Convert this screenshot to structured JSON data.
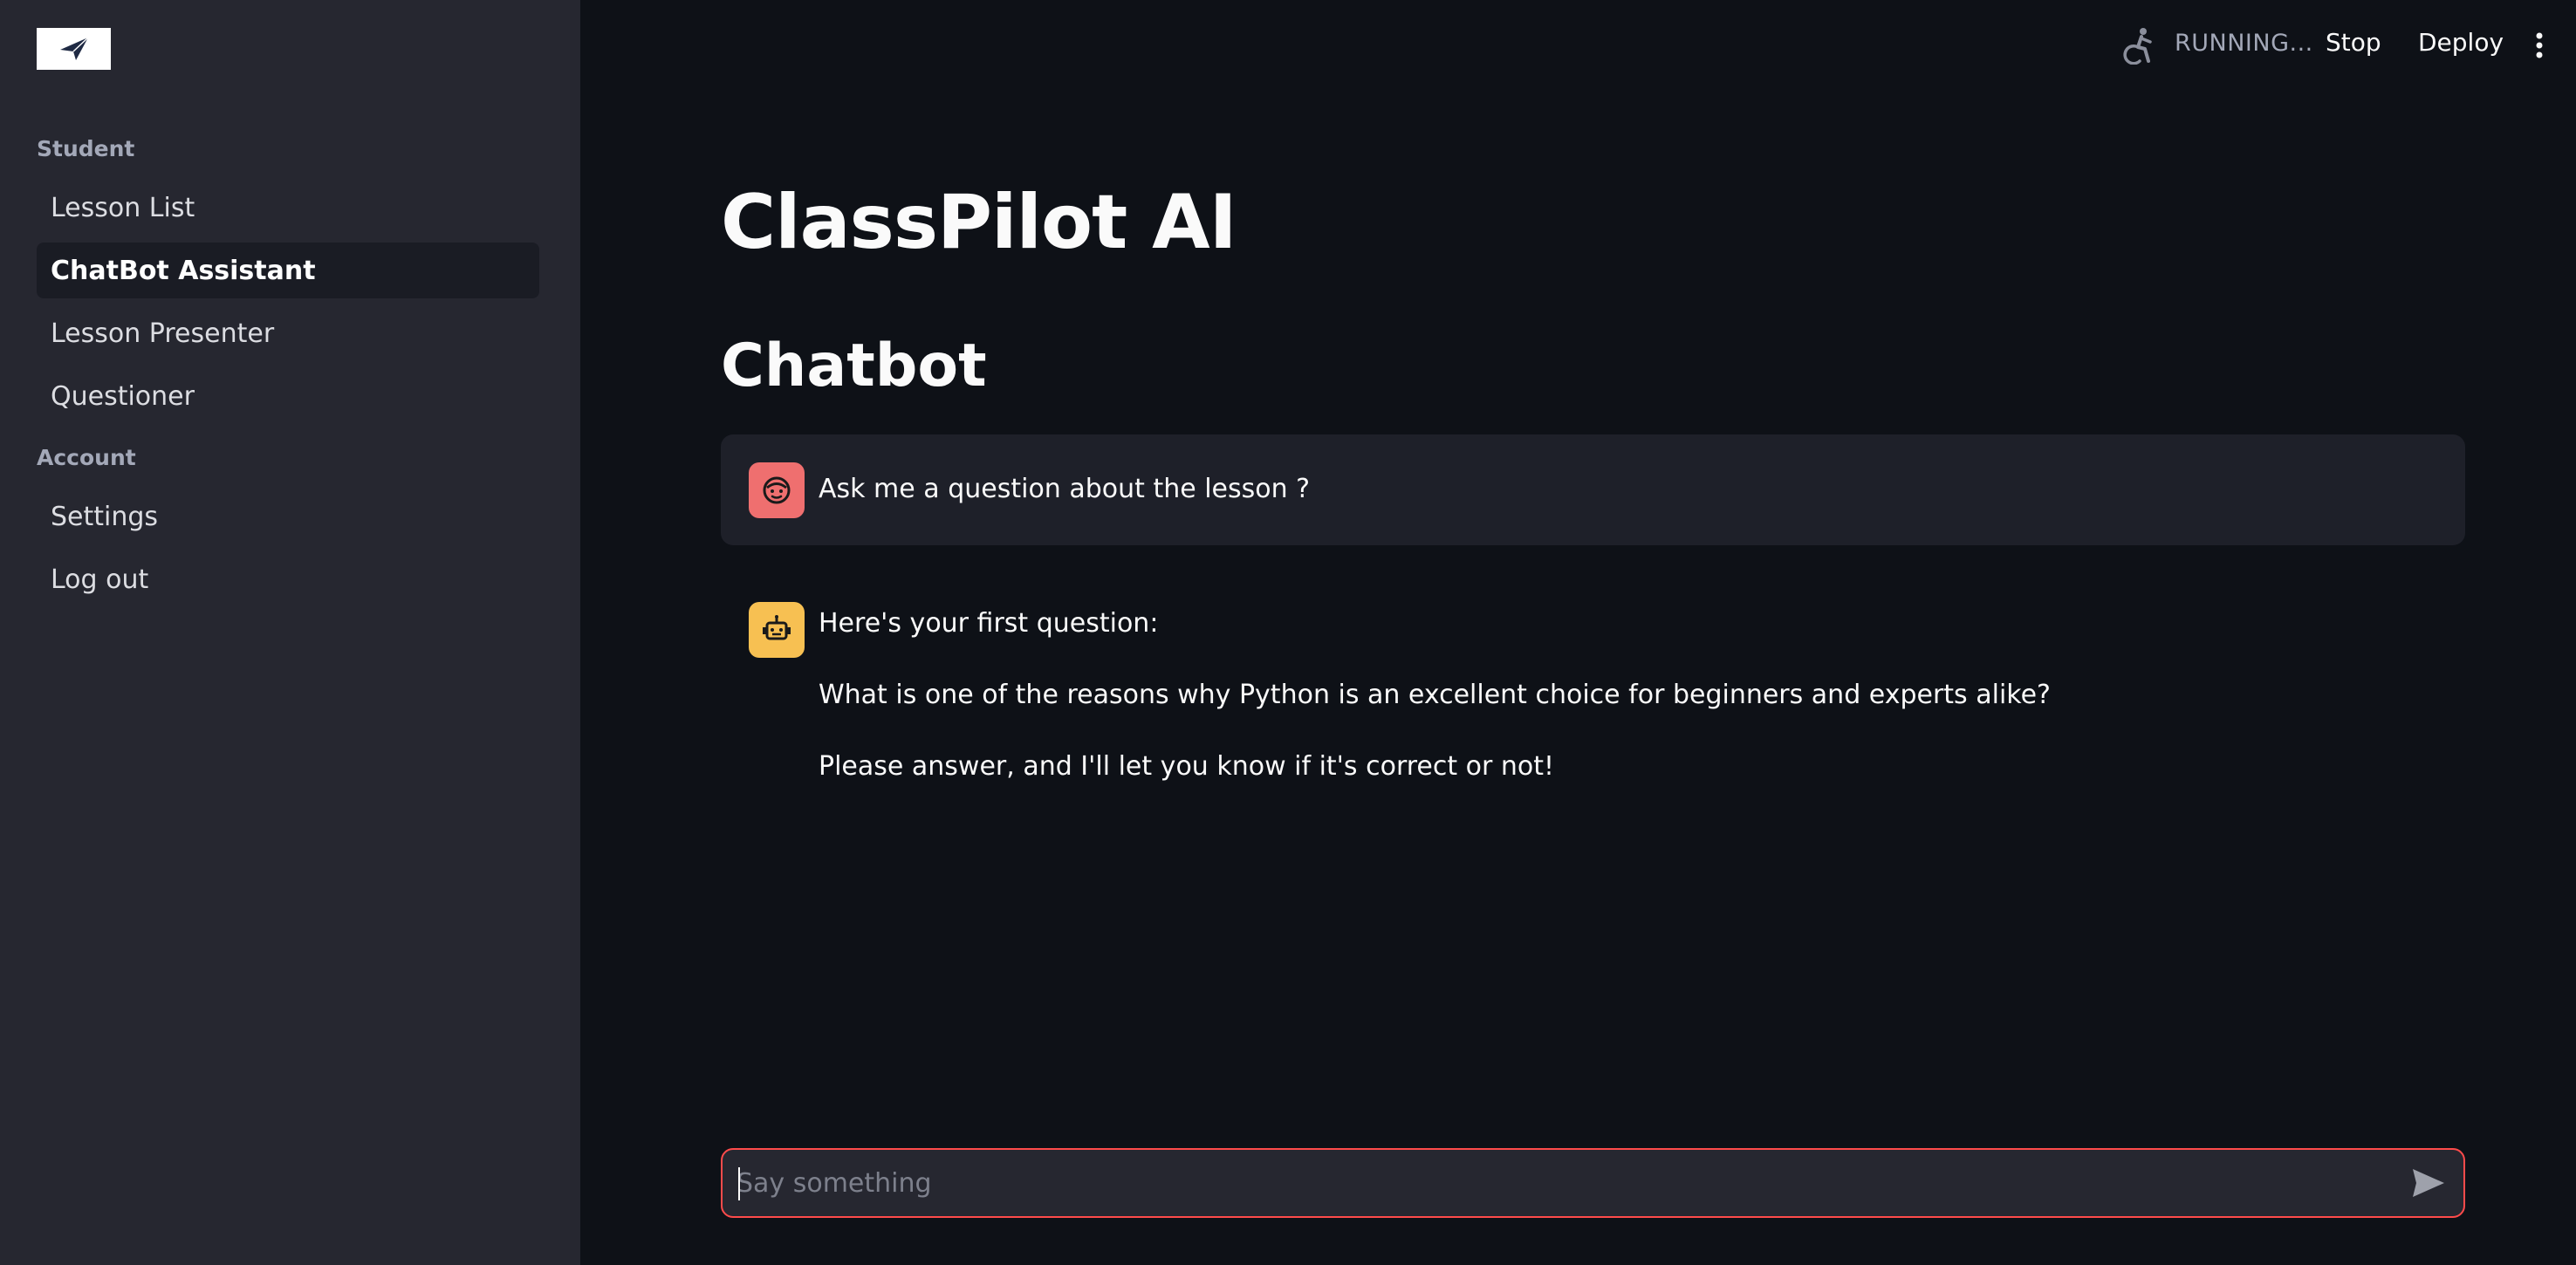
{
  "sidebar": {
    "logo_icon": "paper-plane-icon",
    "sections": [
      {
        "header": "Student",
        "items": [
          {
            "label": "Lesson List",
            "active": false
          },
          {
            "label": "ChatBot Assistant",
            "active": true
          },
          {
            "label": "Lesson Presenter",
            "active": false
          },
          {
            "label": "Questioner",
            "active": false
          }
        ]
      },
      {
        "header": "Account",
        "items": [
          {
            "label": "Settings",
            "active": false
          },
          {
            "label": "Log out",
            "active": false
          }
        ]
      }
    ]
  },
  "header": {
    "status_icon": "running-person-icon",
    "status_text": "RUNNING...",
    "stop_label": "Stop",
    "deploy_label": "Deploy",
    "menu_icon": "kebab-menu-icon"
  },
  "main": {
    "title": "ClassPilot AI",
    "subtitle": "Chatbot",
    "messages": [
      {
        "role": "user",
        "avatar_icon": "user-face-icon",
        "text": [
          "Ask me a question about the lesson ?"
        ]
      },
      {
        "role": "assistant",
        "avatar_icon": "robot-icon",
        "text": [
          "Here's your first question:",
          "What is one of the reasons why Python is an excellent choice for beginners and experts alike?",
          "Please answer, and I'll let you know if it's correct or not!"
        ]
      }
    ]
  },
  "chat_input": {
    "placeholder": "Say something",
    "value": "",
    "send_icon": "send-icon"
  },
  "colors": {
    "background": "#0e1117",
    "sidebar": "#262730",
    "accent": "#ff4b4b",
    "user_avatar": "#ef6f6f",
    "bot_avatar": "#f7c052"
  }
}
